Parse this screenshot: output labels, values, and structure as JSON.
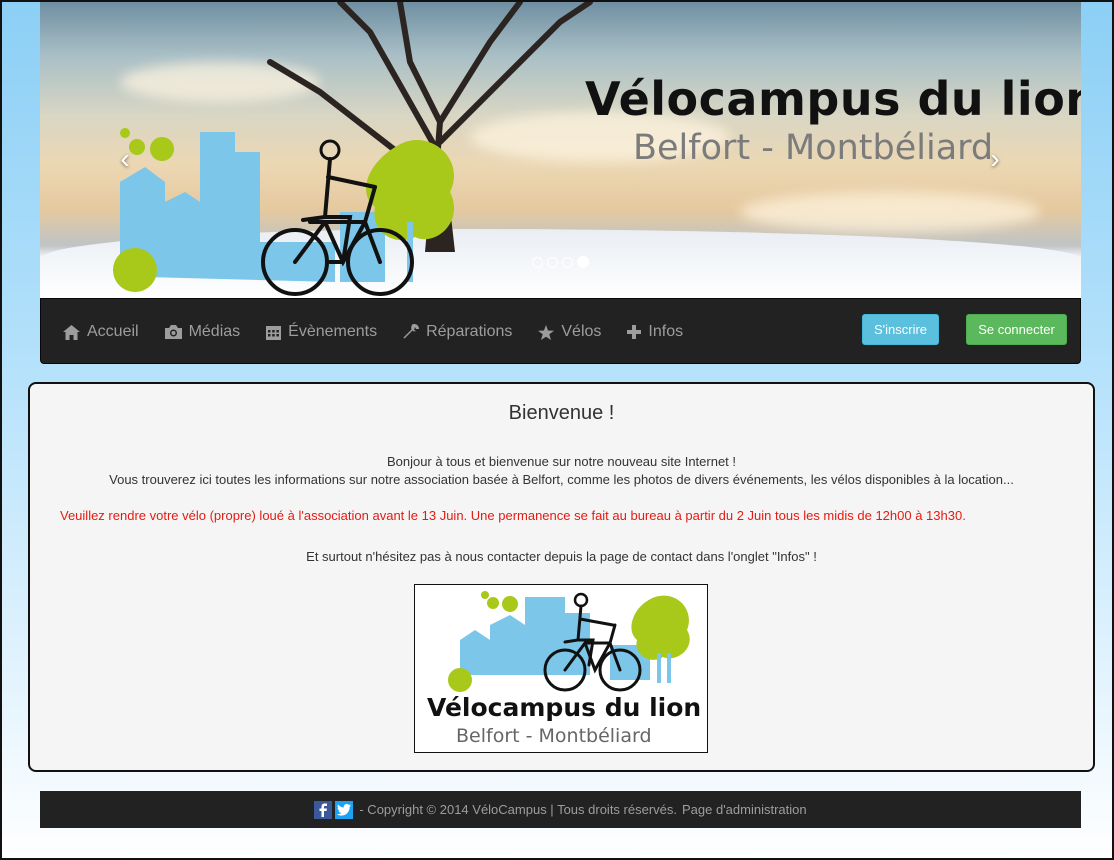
{
  "carousel": {
    "title": "Vélocampus du lion",
    "subtitle": "Belfort - Montbéliard",
    "prev_glyph": "‹",
    "next_glyph": "›",
    "slide_count": 4,
    "active_slide": 4
  },
  "nav": {
    "items": [
      {
        "label": "Accueil",
        "icon": "home-icon"
      },
      {
        "label": "Médias",
        "icon": "camera-icon"
      },
      {
        "label": "Évènements",
        "icon": "calendar-icon"
      },
      {
        "label": "Réparations",
        "icon": "wrench-icon"
      },
      {
        "label": "Vélos",
        "icon": "star-icon"
      },
      {
        "label": "Infos",
        "icon": "plus-icon"
      }
    ],
    "signup_label": "S'inscrire",
    "login_label": "Se connecter"
  },
  "main": {
    "heading": "Bienvenue !",
    "intro_line1": "Bonjour à tous et bienvenue sur notre nouveau site Internet !",
    "intro_line2": "Vous trouverez ici toutes les informations sur notre association basée à Belfort, comme les photos de divers événements, les vélos disponibles à la location...",
    "warning": "Veuillez rendre votre vélo (propre) loué à l'association avant le 13 Juin. Une permanence se fait au bureau à partir du 2 Juin tous les midis de 12h00 à 13h30.",
    "contact_line": "Et surtout n'hésitez pas à nous contacter depuis la page de contact dans l'onglet \"Infos\" !",
    "logo_title": "Vélocampus du lion",
    "logo_subtitle": "Belfort - Montbéliard"
  },
  "footer": {
    "copyright": "- Copyright © 2014 VéloCampus | Tous droits réservés.",
    "admin_link": "Page d'administration",
    "social": [
      "facebook-icon",
      "twitter-icon"
    ]
  },
  "colors": {
    "navbar_bg": "#222222",
    "nav_text": "#9d9d9d",
    "signup_bg": "#5bc0de",
    "login_bg": "#5cb85c",
    "warning_text": "#e41b12",
    "logo_blue": "#7cc6ea",
    "logo_green": "#a8c81a"
  }
}
